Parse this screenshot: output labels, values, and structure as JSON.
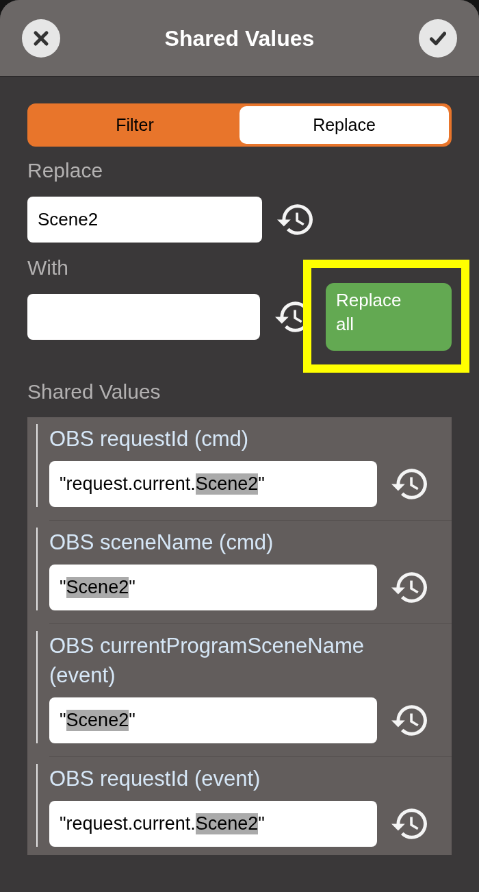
{
  "header": {
    "title": "Shared Values"
  },
  "segments": [
    {
      "label": "Filter",
      "selected": false
    },
    {
      "label": "Replace",
      "selected": true
    }
  ],
  "replace": {
    "label": "Replace",
    "value": "Scene2"
  },
  "with": {
    "label": "With"
  },
  "replace_all": {
    "label": "Replace all",
    "highlighted": true
  },
  "shared_values": {
    "heading": "Shared Values",
    "items": [
      {
        "title": "OBS requestId (cmd)",
        "value_parts": [
          {
            "text": "\"request.current.",
            "match": false
          },
          {
            "text": "Scene2",
            "match": true
          },
          {
            "text": "\"",
            "match": false
          }
        ]
      },
      {
        "title": "OBS sceneName (cmd)",
        "value_parts": [
          {
            "text": "\"",
            "match": false
          },
          {
            "text": "Scene2",
            "match": true
          },
          {
            "text": "\"",
            "match": false
          }
        ]
      },
      {
        "title": "OBS currentProgramSceneName (event)",
        "value_parts": [
          {
            "text": "\"",
            "match": false
          },
          {
            "text": "Scene2",
            "match": true
          },
          {
            "text": "\"",
            "match": false
          }
        ]
      },
      {
        "title": "OBS requestId (event)",
        "value_parts": [
          {
            "text": "\"request.current.",
            "match": false
          },
          {
            "text": "Scene2",
            "match": true
          },
          {
            "text": "\"",
            "match": false
          }
        ]
      }
    ]
  }
}
